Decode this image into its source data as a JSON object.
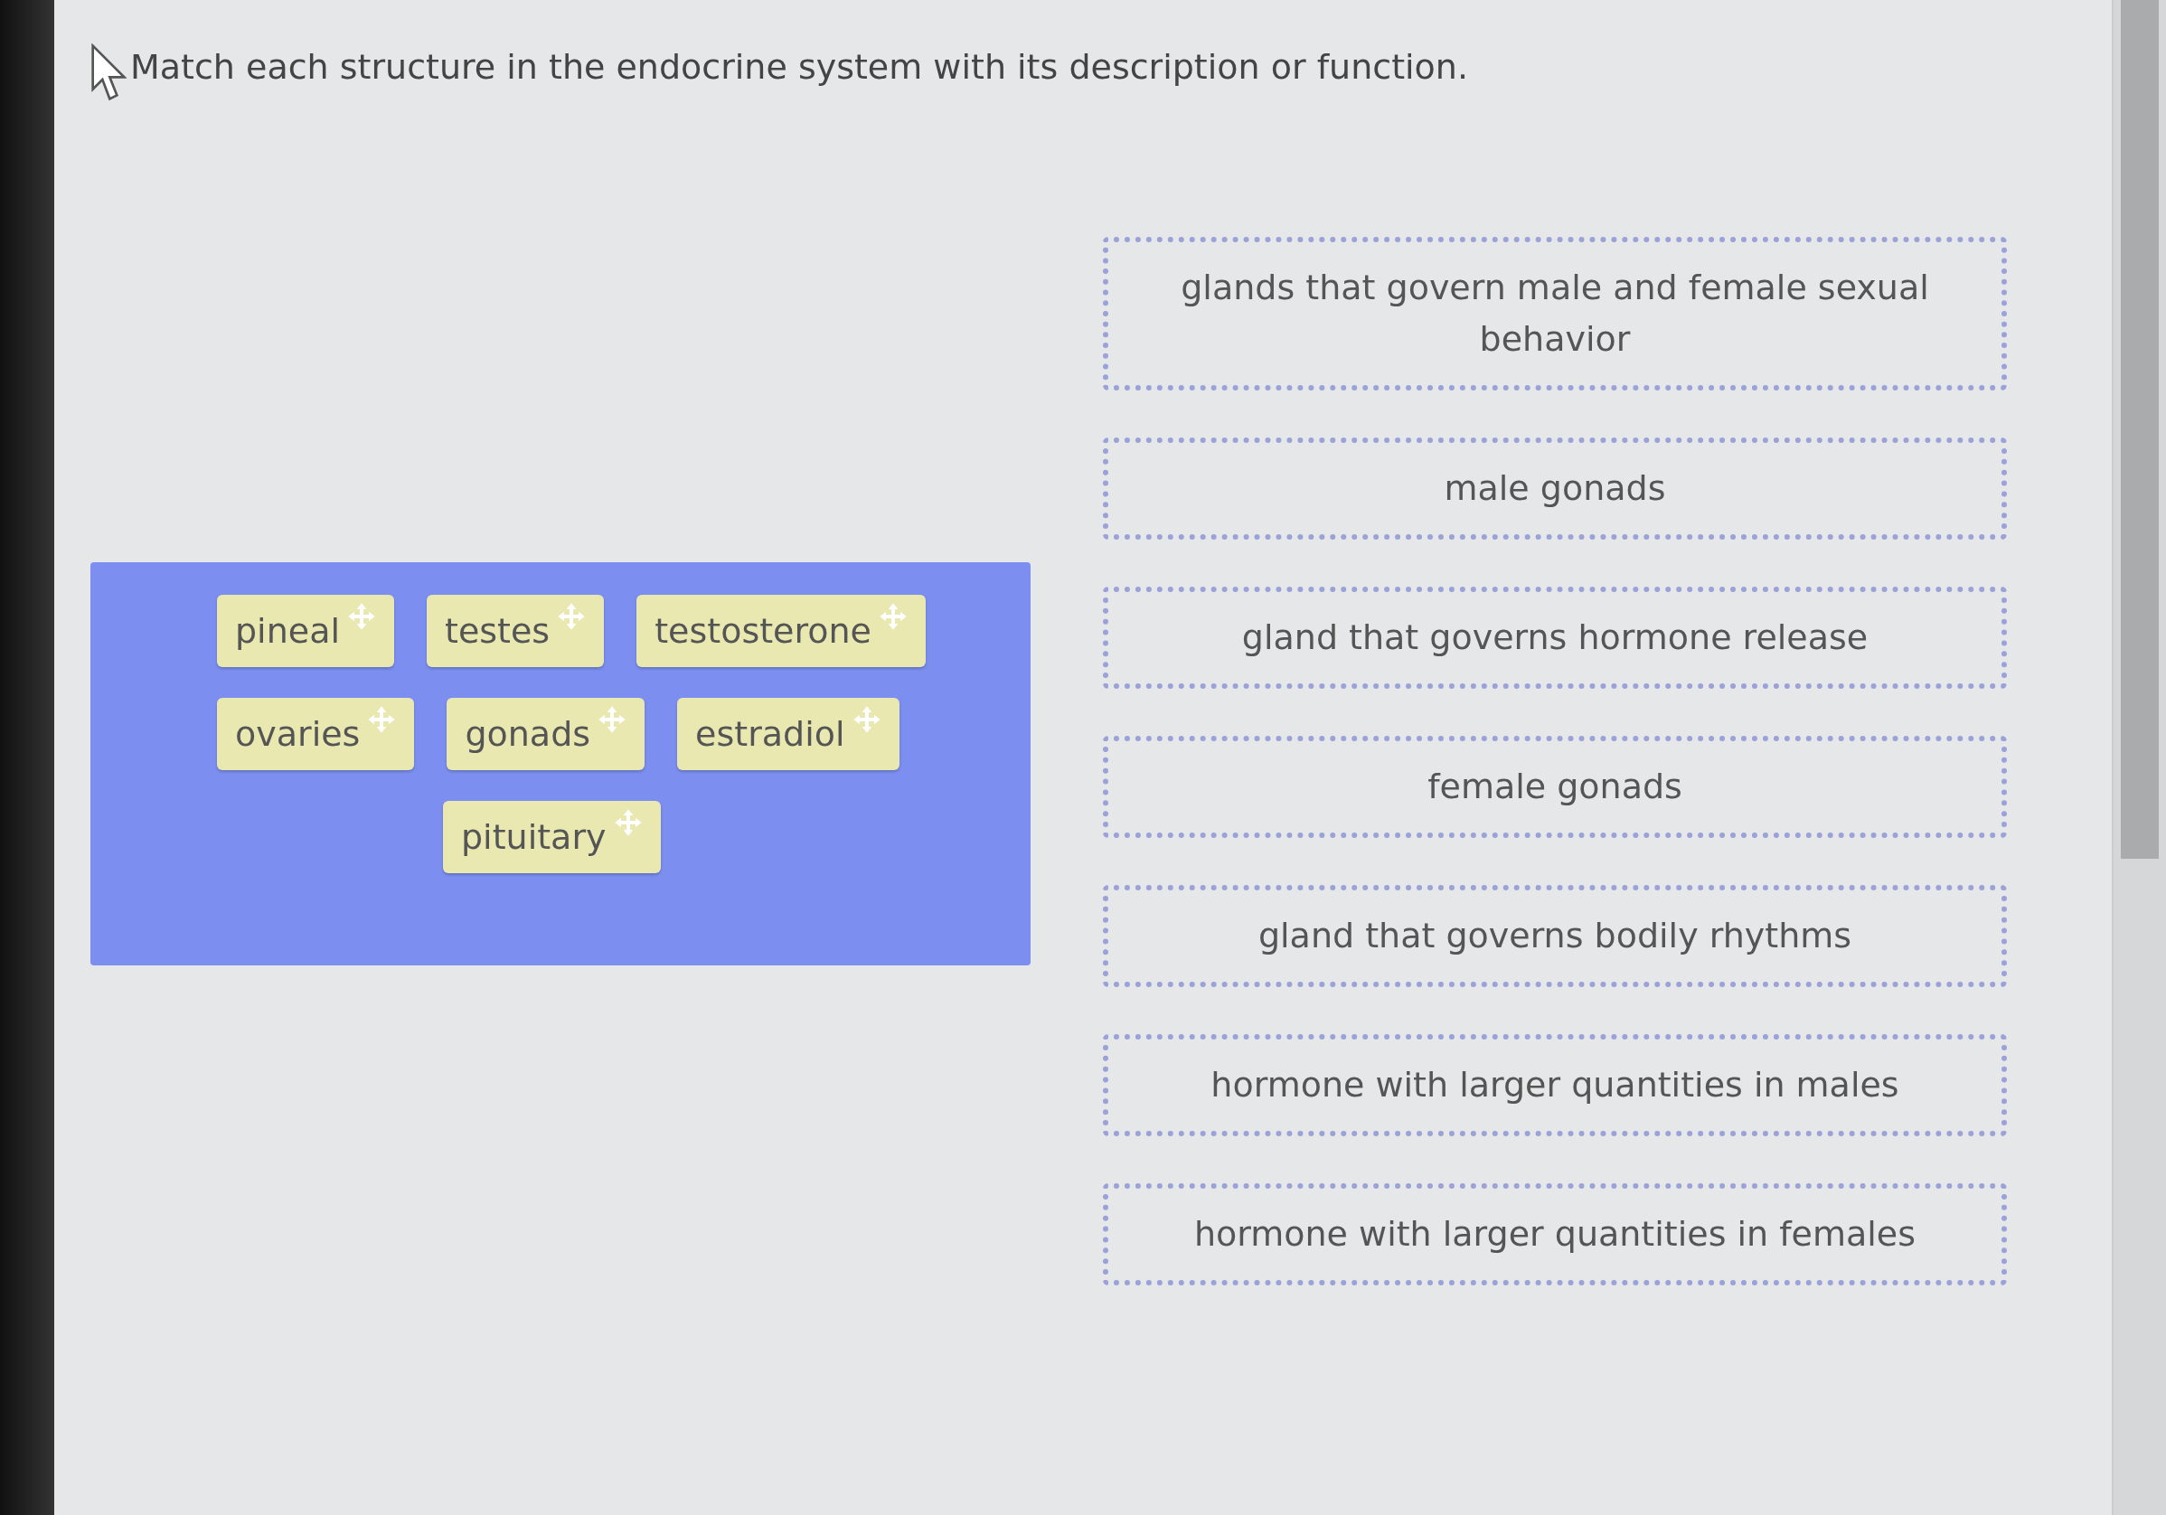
{
  "question": "Match each structure in the endocrine system with its description or function.",
  "tiles": [
    {
      "label": "pineal"
    },
    {
      "label": "testes"
    },
    {
      "label": "testosterone"
    },
    {
      "label": "ovaries"
    },
    {
      "label": "gonads"
    },
    {
      "label": "estradiol"
    },
    {
      "label": "pituitary"
    }
  ],
  "targets": [
    {
      "label": "glands that govern male and female sexual behavior"
    },
    {
      "label": "male gonads"
    },
    {
      "label": "gland that governs hormone release"
    },
    {
      "label": "female gonads"
    },
    {
      "label": "gland that governs bodily rhythms"
    },
    {
      "label": "hormone with larger quantities in males"
    },
    {
      "label": "hormone with larger quantities in females"
    }
  ]
}
